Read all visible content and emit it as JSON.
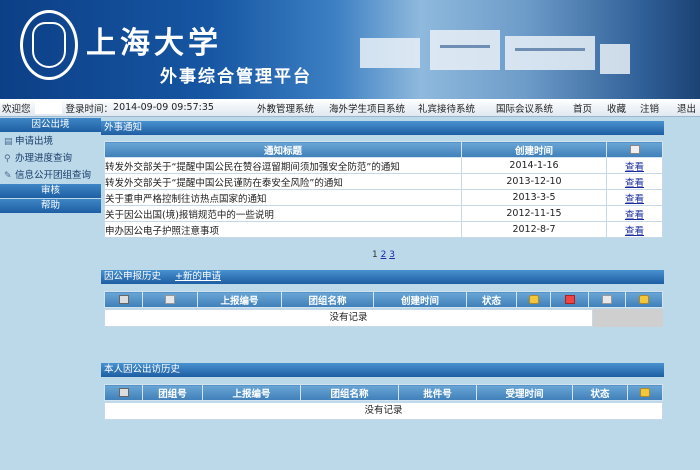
{
  "header": {
    "title": "上海大学",
    "subtitle": "外事综合管理平台"
  },
  "topbar": {
    "welcome": "欢迎您",
    "login_time_label": "登录时间：",
    "login_time": "2014-09-09 09:57:35",
    "nav": [
      "外教管理系统",
      "海外学生项目系统",
      "礼宾接待系统",
      "国际会议系统",
      "首页",
      "收藏",
      "注销",
      "退出"
    ]
  },
  "sidebar": {
    "section1": "因公出境",
    "items": [
      "申请出境",
      "办理进度查询",
      "信息公开团组查询"
    ],
    "section2": "审核",
    "section3": "帮助"
  },
  "notices": {
    "title": "外事通知",
    "col_title": "通知标题",
    "col_time": "创建时间",
    "rows": [
      {
        "title": "转发外交部关于“提醒中国公民在赞谷逗留期间须加强安全防范”的通知",
        "time": "2014-1-16",
        "action": "查看"
      },
      {
        "title": "转发外交部关于“提醒中国公民谨防在泰安全风险”的通知",
        "time": "2013-12-10",
        "action": "查看"
      },
      {
        "title": "关于重申严格控制往访热点国家的通知",
        "time": "2013-3-5",
        "action": "查看"
      },
      {
        "title": "关于因公出国(境)报销规范中的一些说明",
        "time": "2012-11-15",
        "action": "查看"
      },
      {
        "title": "申办因公电子护照注意事项",
        "time": "2012-8-7",
        "action": "查看"
      }
    ],
    "pager": {
      "current": "1",
      "p2": "2",
      "p3": "3"
    }
  },
  "apply_history": {
    "title": "因公申报历史",
    "new_link": "+新的申请",
    "cols": [
      "上报编号",
      "团组名称",
      "创建时间",
      "状态"
    ],
    "empty": "没有记录"
  },
  "visit_history": {
    "title": "本人因公出访历史",
    "cols": [
      "团组号",
      "上报编号",
      "团组名称",
      "批件号",
      "受理时间",
      "状态"
    ],
    "empty": "没有记录"
  },
  "icons": [
    "shield-logo-icon",
    "notice-icon",
    "lock-icon",
    "delete-icon",
    "note-icon",
    "print-icon",
    "edit-icon",
    "search-icon",
    "help-icon"
  ]
}
